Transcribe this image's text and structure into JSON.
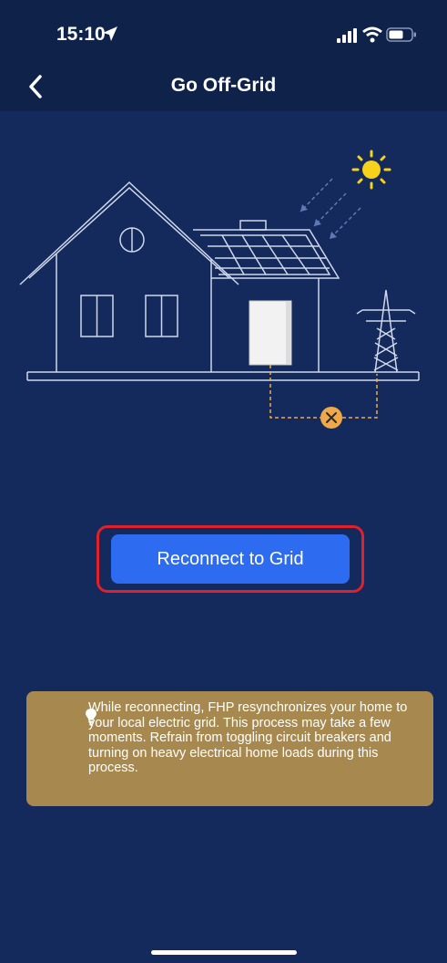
{
  "status_bar": {
    "time": "15:10",
    "icons": [
      "location-arrow-icon",
      "signal-icon",
      "wifi-icon",
      "battery-icon"
    ]
  },
  "header": {
    "title": "Go Off-Grid",
    "back_icon": "chevron-left-icon"
  },
  "main": {
    "reconnect_label": "Reconnect to Grid",
    "info_icon": "lightbulb-icon",
    "info_text": "While reconnecting, FHP resynchronizes your home to your local electric grid. This process may take a few moments. Refrain from toggling circuit breakers and turning on heavy electrical home loads during this process."
  },
  "colors": {
    "background": "#142a5c",
    "header": "#0f2249",
    "primary_button": "#2d6cf0",
    "highlight": "#e0202a",
    "info_box": "#a7894f",
    "sun": "#f6d21a",
    "disconnect": "#f0a94a"
  }
}
